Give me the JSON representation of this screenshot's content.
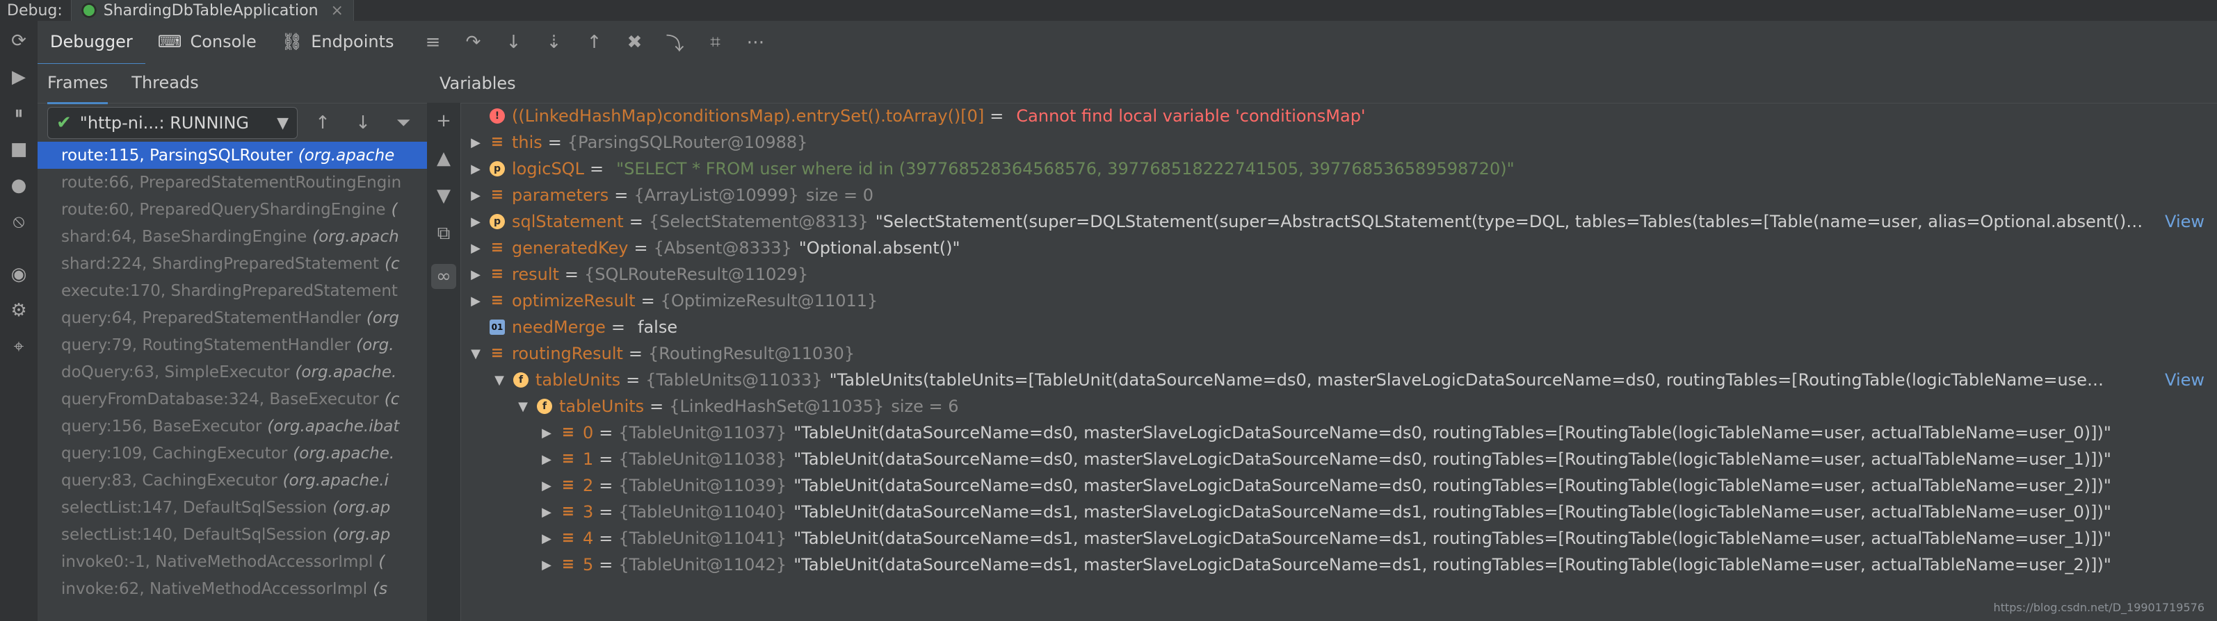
{
  "titlebar": {
    "label": "Debug:",
    "tab_title": "ShardingDbTableApplication",
    "close": "×"
  },
  "toolbar": {
    "tabs": [
      {
        "label": "Debugger"
      },
      {
        "label": "Console"
      },
      {
        "label": "Endpoints"
      }
    ]
  },
  "frames_panel": {
    "tabs": [
      {
        "label": "Frames"
      },
      {
        "label": "Threads"
      }
    ],
    "thread_selector": {
      "value": "\"http-ni...: RUNNING"
    },
    "frames": [
      {
        "method": "route:115, ParsingSQLRouter",
        "pkg": "(org.apache"
      },
      {
        "method": "route:66, PreparedStatementRoutingEngin",
        "pkg": ""
      },
      {
        "method": "route:60, PreparedQueryShardingEngine",
        "pkg": "("
      },
      {
        "method": "shard:64, BaseShardingEngine",
        "pkg": "(org.apach"
      },
      {
        "method": "shard:224, ShardingPreparedStatement",
        "pkg": "(c"
      },
      {
        "method": "execute:170, ShardingPreparedStatement",
        "pkg": ""
      },
      {
        "method": "query:64, PreparedStatementHandler",
        "pkg": "(org"
      },
      {
        "method": "query:79, RoutingStatementHandler",
        "pkg": "(org."
      },
      {
        "method": "doQuery:63, SimpleExecutor",
        "pkg": "(org.apache."
      },
      {
        "method": "queryFromDatabase:324, BaseExecutor",
        "pkg": "(c"
      },
      {
        "method": "query:156, BaseExecutor",
        "pkg": "(org.apache.ibat"
      },
      {
        "method": "query:109, CachingExecutor",
        "pkg": "(org.apache."
      },
      {
        "method": "query:83, CachingExecutor",
        "pkg": "(org.apache.i"
      },
      {
        "method": "selectList:147, DefaultSqlSession",
        "pkg": "(org.ap"
      },
      {
        "method": "selectList:140, DefaultSqlSession",
        "pkg": "(org.ap"
      },
      {
        "method": "invoke0:-1, NativeMethodAccessorImpl",
        "pkg": "("
      },
      {
        "method": "invoke:62, NativeMethodAccessorImpl",
        "pkg": "(s"
      }
    ]
  },
  "variables_panel": {
    "title": "Variables",
    "rows": [
      {
        "kind": "error",
        "indent": 0,
        "toggle": "",
        "icon": "!",
        "name": "((LinkedHashMap)conditionsMap).entrySet().toArray()[0]",
        "eq": "=",
        "ref": "",
        "value": "Cannot find local variable 'conditionsMap'",
        "value_class": "err-text",
        "size_text": "",
        "view": ""
      },
      {
        "kind": "field",
        "indent": 0,
        "toggle": "▶",
        "icon": "",
        "name": "this",
        "eq": "=",
        "ref": "{ParsingSQLRouter@10988}",
        "value": "",
        "value_class": "",
        "size_text": "",
        "view": ""
      },
      {
        "kind": "p",
        "indent": 0,
        "toggle": "▶",
        "icon": "p",
        "name": "logicSQL",
        "eq": "=",
        "ref": "",
        "value": "\"SELECT * FROM user where id in (397768528364568576, 397768518222741505, 397768536589598720)\"",
        "value_class": "str",
        "size_text": "",
        "view": ""
      },
      {
        "kind": "field",
        "indent": 0,
        "toggle": "▶",
        "icon": "",
        "name": "parameters",
        "eq": "=",
        "ref": "{ArrayList@10999}",
        "value": "",
        "value_class": "",
        "size_text": "size = 0",
        "view": ""
      },
      {
        "kind": "p",
        "indent": 0,
        "toggle": "▶",
        "icon": "p",
        "name": "sqlStatement",
        "eq": "=",
        "ref": "{SelectStatement@8313}",
        "value": "\"SelectStatement(super=DQLStatement(super=AbstractSQLStatement(type=DQL, tables=Tables(tables=[Table(name=user, alias=Optional.absent()…",
        "value_class": "",
        "size_text": "",
        "view": "View"
      },
      {
        "kind": "field",
        "indent": 0,
        "toggle": "▶",
        "icon": "",
        "name": "generatedKey",
        "eq": "=",
        "ref": "{Absent@8333}",
        "value": "\"Optional.absent()\"",
        "value_class": "",
        "size_text": "",
        "view": ""
      },
      {
        "kind": "field",
        "indent": 0,
        "toggle": "▶",
        "icon": "",
        "name": "result",
        "eq": "=",
        "ref": "{SQLRouteResult@11029}",
        "value": "",
        "value_class": "",
        "size_text": "",
        "view": ""
      },
      {
        "kind": "field",
        "indent": 0,
        "toggle": "▶",
        "icon": "",
        "name": "optimizeResult",
        "eq": "=",
        "ref": "{OptimizeResult@11011}",
        "value": "",
        "value_class": "",
        "size_text": "",
        "view": ""
      },
      {
        "kind": "bool",
        "indent": 0,
        "toggle": "",
        "icon": "01",
        "name": "needMerge",
        "eq": "=",
        "ref": "",
        "value": "false",
        "value_class": "",
        "size_text": "",
        "view": ""
      },
      {
        "kind": "field",
        "indent": 0,
        "toggle": "▼",
        "icon": "",
        "name": "routingResult",
        "eq": "=",
        "ref": "{RoutingResult@11030}",
        "value": "",
        "value_class": "",
        "size_text": "",
        "view": ""
      },
      {
        "kind": "f",
        "indent": 1,
        "toggle": "▼",
        "icon": "f",
        "name": "tableUnits",
        "eq": "=",
        "ref": "{TableUnits@11033}",
        "value": "\"TableUnits(tableUnits=[TableUnit(dataSourceName=ds0, masterSlaveLogicDataSourceName=ds0, routingTables=[RoutingTable(logicTableName=use…",
        "value_class": "",
        "size_text": "",
        "view": "View"
      },
      {
        "kind": "f",
        "indent": 2,
        "toggle": "▼",
        "icon": "f",
        "name": "tableUnits",
        "eq": "=",
        "ref": "{LinkedHashSet@11035}",
        "value": "",
        "value_class": "",
        "size_text": "size = 6",
        "view": ""
      },
      {
        "kind": "field",
        "indent": 3,
        "toggle": "▶",
        "icon": "",
        "name": "0",
        "eq": "=",
        "ref": "{TableUnit@11037}",
        "value": "\"TableUnit(dataSourceName=ds0, masterSlaveLogicDataSourceName=ds0, routingTables=[RoutingTable(logicTableName=user, actualTableName=user_0)])\"",
        "value_class": "",
        "size_text": "",
        "view": ""
      },
      {
        "kind": "field",
        "indent": 3,
        "toggle": "▶",
        "icon": "",
        "name": "1",
        "eq": "=",
        "ref": "{TableUnit@11038}",
        "value": "\"TableUnit(dataSourceName=ds0, masterSlaveLogicDataSourceName=ds0, routingTables=[RoutingTable(logicTableName=user, actualTableName=user_1)])\"",
        "value_class": "",
        "size_text": "",
        "view": ""
      },
      {
        "kind": "field",
        "indent": 3,
        "toggle": "▶",
        "icon": "",
        "name": "2",
        "eq": "=",
        "ref": "{TableUnit@11039}",
        "value": "\"TableUnit(dataSourceName=ds0, masterSlaveLogicDataSourceName=ds0, routingTables=[RoutingTable(logicTableName=user, actualTableName=user_2)])\"",
        "value_class": "",
        "size_text": "",
        "view": ""
      },
      {
        "kind": "field",
        "indent": 3,
        "toggle": "▶",
        "icon": "",
        "name": "3",
        "eq": "=",
        "ref": "{TableUnit@11040}",
        "value": "\"TableUnit(dataSourceName=ds1, masterSlaveLogicDataSourceName=ds1, routingTables=[RoutingTable(logicTableName=user, actualTableName=user_0)])\"",
        "value_class": "",
        "size_text": "",
        "view": ""
      },
      {
        "kind": "field",
        "indent": 3,
        "toggle": "▶",
        "icon": "",
        "name": "4",
        "eq": "=",
        "ref": "{TableUnit@11041}",
        "value": "\"TableUnit(dataSourceName=ds1, masterSlaveLogicDataSourceName=ds1, routingTables=[RoutingTable(logicTableName=user, actualTableName=user_1)])\"",
        "value_class": "",
        "size_text": "",
        "view": ""
      },
      {
        "kind": "field",
        "indent": 3,
        "toggle": "▶",
        "icon": "",
        "name": "5",
        "eq": "=",
        "ref": "{TableUnit@11042}",
        "value": "\"TableUnit(dataSourceName=ds1, masterSlaveLogicDataSourceName=ds1, routingTables=[RoutingTable(logicTableName=user, actualTableName=user_2)])\"",
        "value_class": "",
        "size_text": "",
        "view": ""
      }
    ]
  },
  "watermark": "https://blog.csdn.net/D_19901719576"
}
